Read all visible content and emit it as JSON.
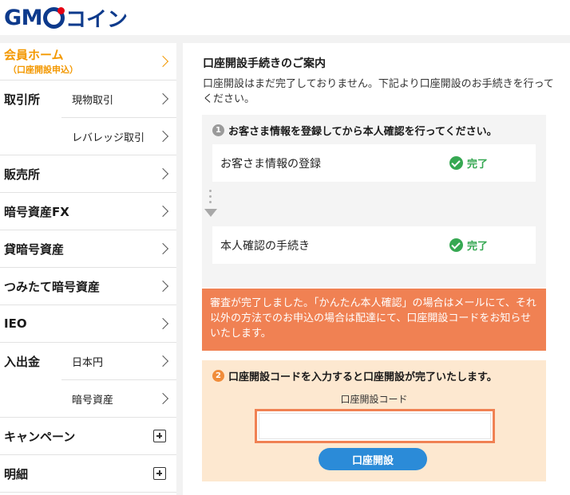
{
  "header": {
    "logo_latin_left": "GM",
    "logo_latin_right": "",
    "logo_kana": "コイン",
    "logo_text": "GMOコイン"
  },
  "sidebar": {
    "home": {
      "label": "会員ホーム",
      "sublabel": "（口座開設申込）"
    },
    "trade": {
      "label": "取引所",
      "items": [
        "現物取引",
        "レバレッジ取引"
      ]
    },
    "hanbai": {
      "label": "販売所"
    },
    "fx": {
      "label": "暗号資産FX"
    },
    "lending": {
      "label": "貸暗号資産"
    },
    "tsumitate": {
      "label": "つみたて暗号資産"
    },
    "ieo": {
      "label": "IEO"
    },
    "deposit": {
      "label": "入出金",
      "items": [
        "日本円",
        "暗号資産"
      ]
    },
    "campaign": {
      "label": "キャンペーン"
    },
    "statement": {
      "label": "明細"
    }
  },
  "main": {
    "title": "口座開設手続きのご案内",
    "description": "口座開設はまだ完了しておりません。下記より口座開設のお手続きを行ってください。",
    "step1": {
      "number": "1",
      "heading": "お客さま情報を登録してから本人確認を行ってください。",
      "item1": "お客さま情報の登録",
      "item2": "本人確認の手続き",
      "status": "完了"
    },
    "notice": "審査が完了しました。「かんたん本人確認」の場合はメールにて、それ以外の方法でのお申込の場合は配達にて、口座開設コードをお知らせいたします。",
    "step2": {
      "number": "2",
      "heading": "口座開設コードを入力すると口座開設が完了いたします。",
      "code_label": "口座開設コード",
      "code_value": "",
      "button": "口座開設"
    }
  },
  "colors": {
    "brand_blue": "#0d3a8c",
    "accent_orange": "#f39800",
    "notice_bg": "#f08153",
    "code_bg": "#fde8d0",
    "done_green": "#36a852",
    "button_blue": "#2b8bd8"
  }
}
